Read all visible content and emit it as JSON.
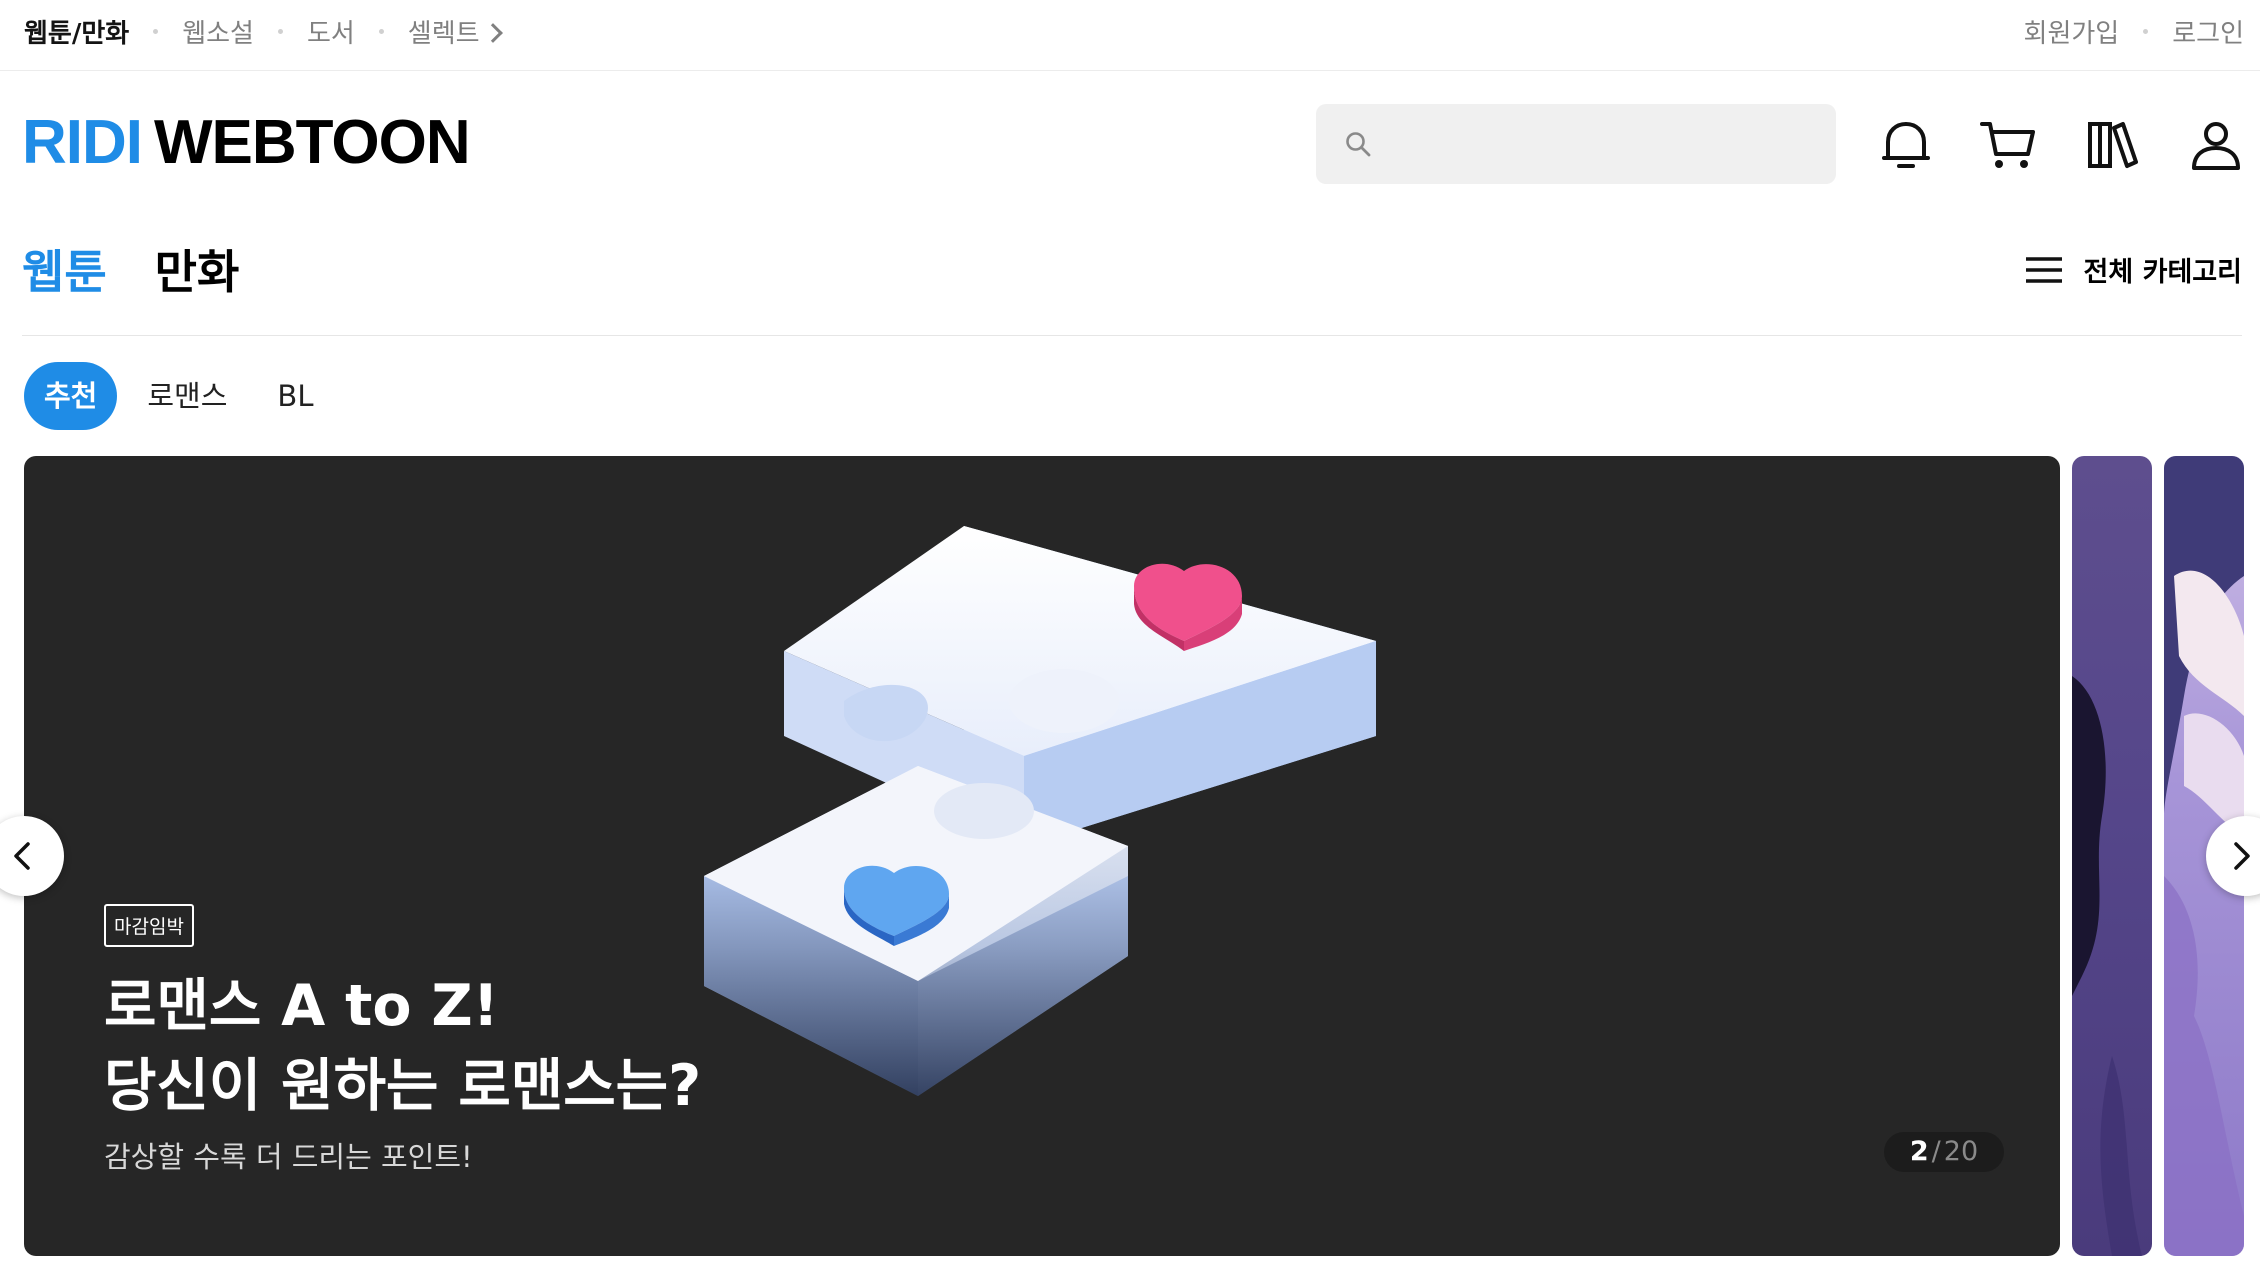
{
  "top_nav": {
    "items": [
      "웹툰/만화",
      "웹소설",
      "도서",
      "셀렉트"
    ],
    "signup": "회원가입",
    "login": "로그인"
  },
  "header": {
    "logo_part1": "RIDI",
    "logo_part2": "WEBTOON",
    "search_placeholder": "",
    "icons": [
      "bell-icon",
      "cart-icon",
      "library-icon",
      "user-icon"
    ]
  },
  "main_tabs": [
    "웹툰",
    "만화"
  ],
  "all_categories": "전체 카테고리",
  "sub_tabs": [
    "추천",
    "로맨스",
    "BL"
  ],
  "banner": {
    "tag": "마감임박",
    "title_line1": "로맨스 A to Z!",
    "title_line2": "당신이 원하는 로맨스는?",
    "subtitle": "감상할 수록 더 드리는 포인트!",
    "counter_current": "2",
    "counter_total": "20"
  },
  "colors": {
    "accent": "#1f8ce6",
    "banner_bg": "#262626",
    "heart_pink": "#f0508c",
    "heart_blue": "#5fa6f0"
  }
}
